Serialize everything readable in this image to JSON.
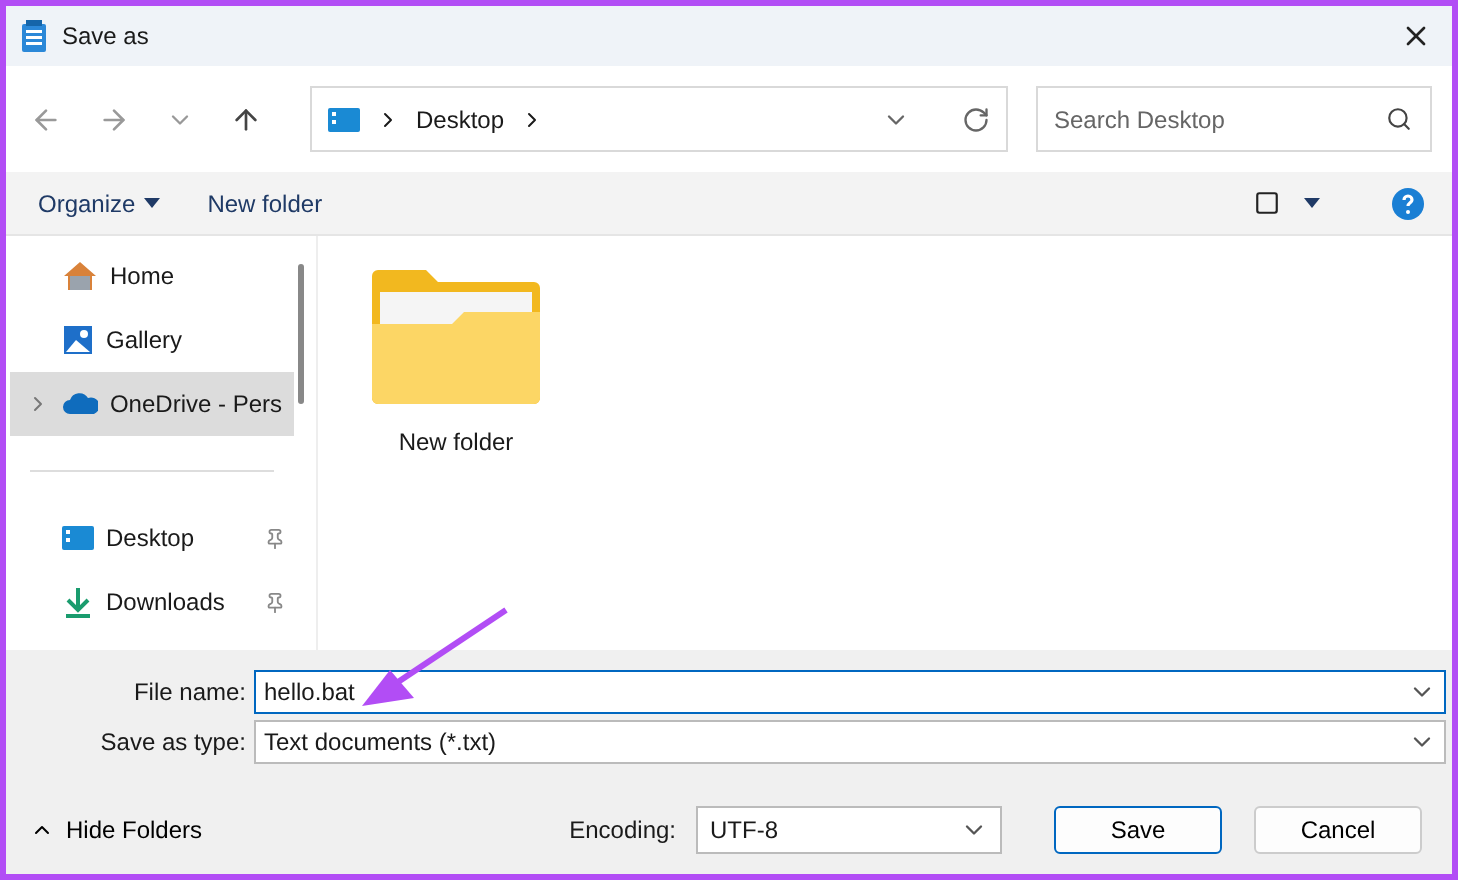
{
  "window": {
    "title": "Save as"
  },
  "address": {
    "path": [
      "Desktop"
    ]
  },
  "search": {
    "placeholder": "Search Desktop"
  },
  "toolbar": {
    "organize": "Organize",
    "new_folder": "New folder"
  },
  "sidebar": {
    "items": [
      {
        "label": "Home",
        "kind": "home",
        "selected": false,
        "pinned": false,
        "expandable": false
      },
      {
        "label": "Gallery",
        "kind": "gallery",
        "selected": false,
        "pinned": false,
        "expandable": false
      },
      {
        "label": "OneDrive - Pers",
        "kind": "cloud",
        "selected": true,
        "pinned": false,
        "expandable": true
      },
      {
        "kind": "divider"
      },
      {
        "label": "Desktop",
        "kind": "desktop",
        "selected": false,
        "pinned": true,
        "expandable": false
      },
      {
        "label": "Downloads",
        "kind": "download",
        "selected": false,
        "pinned": true,
        "expandable": false
      }
    ]
  },
  "files": [
    {
      "name": "New folder"
    }
  ],
  "form": {
    "file_name_label": "File name:",
    "file_name": "hello.bat",
    "type_label": "Save as type:",
    "type": "Text documents (*.txt)"
  },
  "footer": {
    "hide_folders": "Hide Folders",
    "encoding_label": "Encoding:",
    "encoding": "UTF-8",
    "save": "Save",
    "cancel": "Cancel"
  }
}
